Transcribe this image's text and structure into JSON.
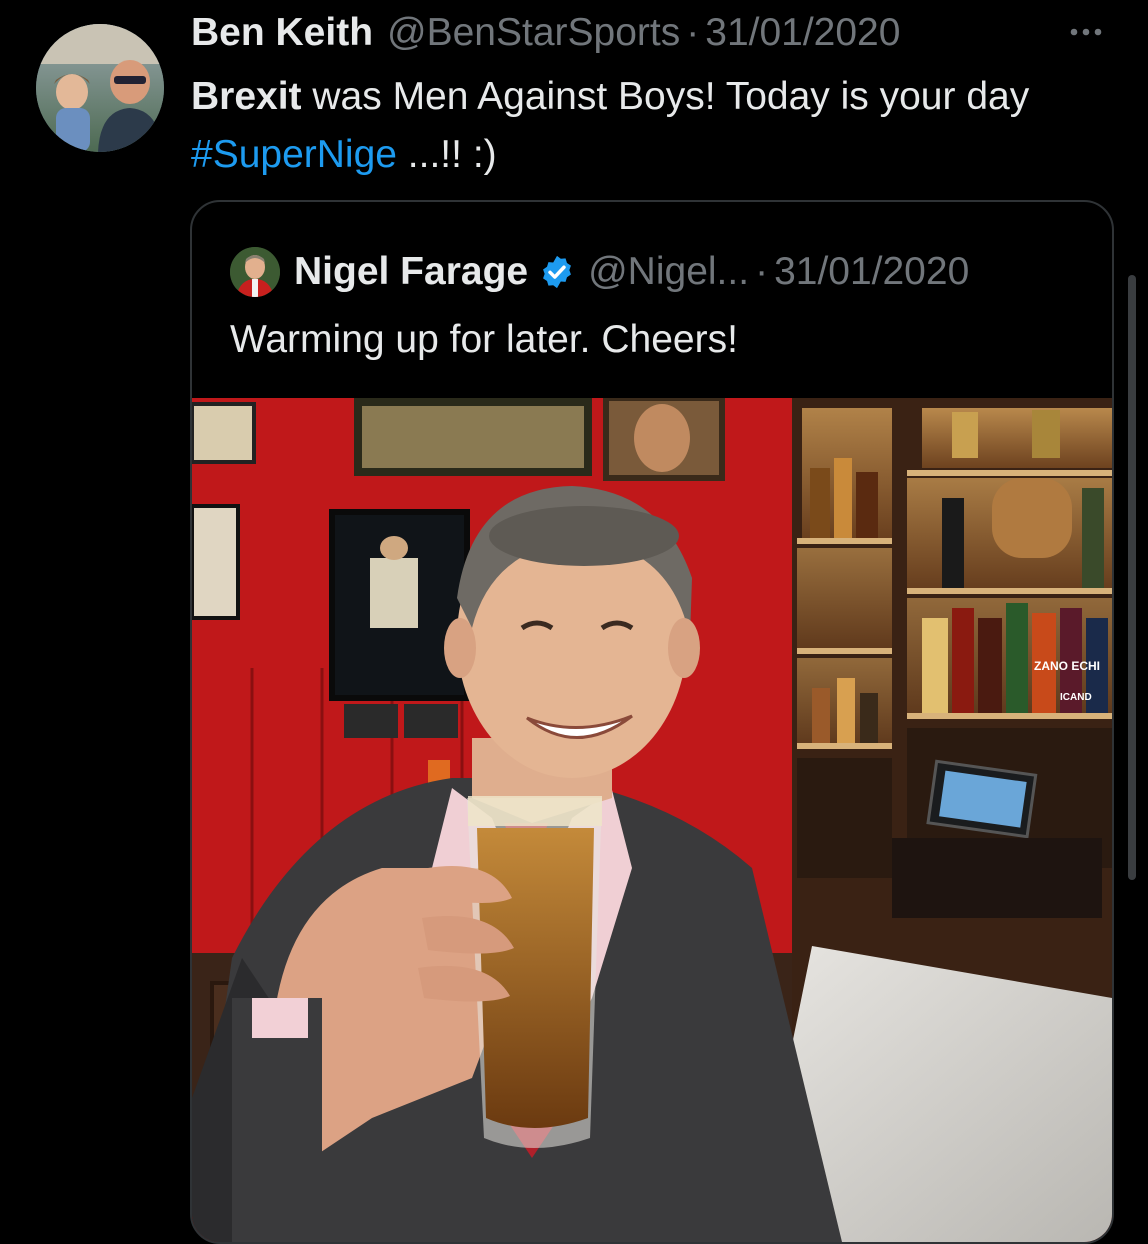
{
  "tweet": {
    "author_name": "Ben Keith",
    "author_handle": "@BenStarSports",
    "separator": "·",
    "date": "31/01/2020",
    "more_label": "···",
    "text_bold": "Brexit",
    "text_part1": " was Men Against Boys!  Today is your day ",
    "hashtag": "#SuperNige",
    "text_part2": " ...!!  :)"
  },
  "quoted_tweet": {
    "author_name": "Nigel Farage",
    "verified": true,
    "author_handle": "@Nigel...",
    "separator": "·",
    "date": "31/01/2020",
    "text": "Warming up for later. Cheers!",
    "photo": {
      "sign_text": "ZANO  ECHI",
      "label_text": "ICAND"
    }
  },
  "colors": {
    "background": "#000000",
    "text": "#e7e9ea",
    "secondary_text": "#71767b",
    "hashtag": "#1d9bf0",
    "verified_badge": "#1d9bf0",
    "card_border": "#2f3336"
  }
}
